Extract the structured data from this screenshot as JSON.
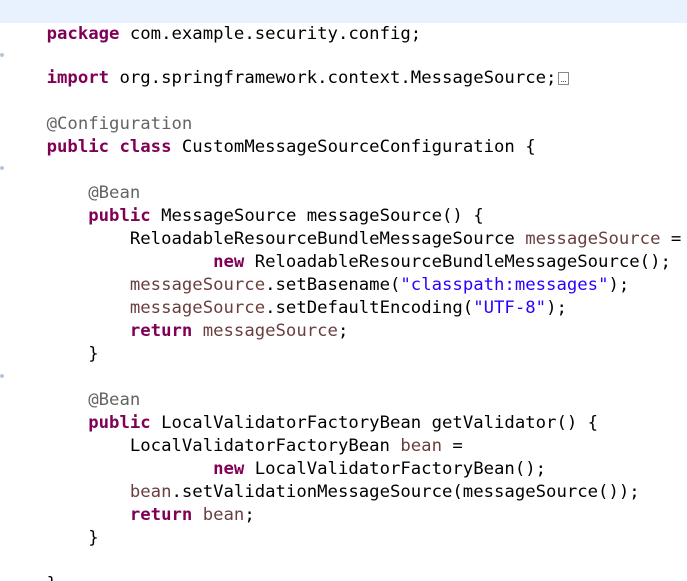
{
  "editor": {
    "lines": {
      "l1_kw": "package",
      "l1_rest": " com.example.security.config;",
      "l2_kw": "import",
      "l2_rest": " org.springframework.context.MessageSource;",
      "l3_ann": "@Configuration",
      "l4_kw1": "public",
      "l4_kw2": "class",
      "l4_rest": " CustomMessageSourceConfiguration {",
      "l5_ann": "@Bean",
      "l6_kw": "public",
      "l6_rest": " MessageSource messageSource() {",
      "l7_type": "ReloadableResourceBundleMessageSource ",
      "l7_var": "messageSource",
      "l7_rest": " =",
      "l8_kw": "new",
      "l8_rest": " ReloadableResourceBundleMessageSource();",
      "l9_var": "messageSource",
      "l9_call": ".setBasename(",
      "l9_str": "\"classpath:messages\"",
      "l9_end": ");",
      "l10_var": "messageSource",
      "l10_call": ".setDefaultEncoding(",
      "l10_str": "\"UTF-8\"",
      "l10_end": ");",
      "l11_kw": "return",
      "l11_var": "messageSource",
      "l11_end": ";",
      "l12": "}",
      "l13_ann": "@Bean",
      "l14_kw": "public",
      "l14_rest": " LocalValidatorFactoryBean getValidator() {",
      "l15_type": "LocalValidatorFactoryBean ",
      "l15_var": "bean",
      "l15_rest": " =",
      "l16_kw": "new",
      "l16_rest": " LocalValidatorFactoryBean();",
      "l17_var": "bean",
      "l17_rest": ".setValidationMessageSource(messageSource());",
      "l18_kw": "return",
      "l18_var": "bean",
      "l18_end": ";",
      "l19": "}",
      "l20": "}"
    }
  },
  "colors": {
    "keyword": "#7f0055",
    "annotation": "#646464",
    "string": "#2a00ff",
    "local_variable": "#6a3e3e",
    "current_line": "#e8f2fe"
  },
  "icons": {
    "collapsed_imports": "collapsed-import-box-icon",
    "fold_marker": "fold-marker-icon"
  }
}
